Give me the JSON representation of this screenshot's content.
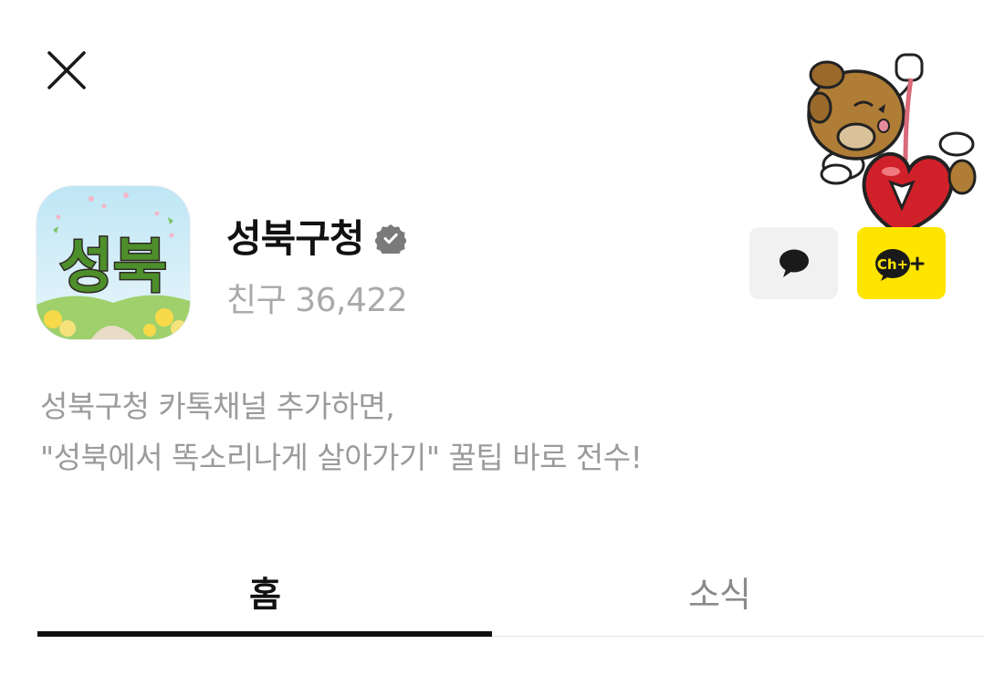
{
  "header": {
    "close_icon": "close-icon"
  },
  "profile": {
    "logo_text": "성북",
    "name": "성북구청",
    "verified_icon": "verified-badge-icon",
    "friends_label": "친구",
    "friends_count": "36,422"
  },
  "actions": {
    "chat_icon": "speech-bubble-icon",
    "add_channel_text": "Ch+",
    "accent_color": "#fee500"
  },
  "intro": {
    "line1": "성북구청 카톡채널 추가하면,",
    "line2": "\"성북에서 똑소리나게 살아가기\" 꿀팁 바로 전수!"
  },
  "tabs": [
    {
      "label": "홈",
      "active": true
    },
    {
      "label": "소식",
      "active": false
    }
  ]
}
